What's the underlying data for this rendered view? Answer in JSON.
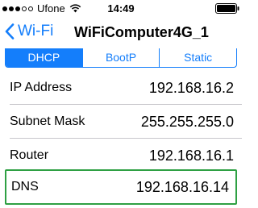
{
  "status_bar": {
    "carrier": "Ufone",
    "time": "14:49",
    "signal_bars_filled": 3,
    "signal_bars_total": 5
  },
  "nav": {
    "back_label": "Wi-Fi",
    "title": "WiFiComputer4G_1"
  },
  "segments": [
    {
      "label": "DHCP",
      "active": true
    },
    {
      "label": "BootP",
      "active": false
    },
    {
      "label": "Static",
      "active": false
    }
  ],
  "rows": [
    {
      "label": "IP Address",
      "value": "192.168.16.2"
    },
    {
      "label": "Subnet Mask",
      "value": "255.255.255.0"
    },
    {
      "label": "Router",
      "value": "192.168.16.1"
    }
  ],
  "dns": {
    "label": "DNS",
    "value": "192.168.16.14"
  },
  "colors": {
    "accent": "#147efb",
    "highlight": "#2ea043",
    "separator": "#c8c7cc"
  }
}
